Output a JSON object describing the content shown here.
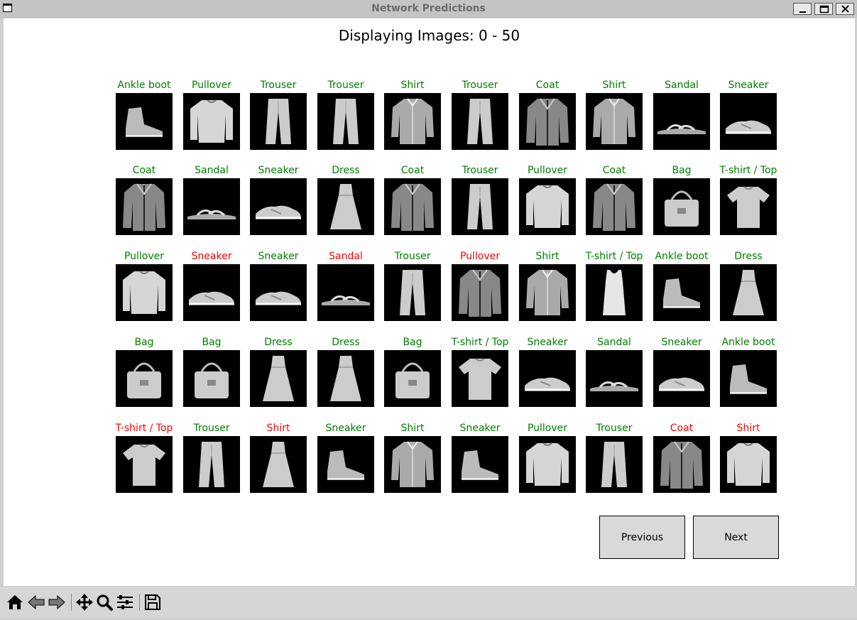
{
  "window": {
    "title": "Network Predictions"
  },
  "figure": {
    "title": "Displaying Images: 0 - 50"
  },
  "colors": {
    "correct": "#008000",
    "incorrect": "#ff0000"
  },
  "grid": [
    [
      {
        "label": "Ankle boot",
        "correct": true,
        "item": "ankle-boot"
      },
      {
        "label": "Pullover",
        "correct": true,
        "item": "pullover"
      },
      {
        "label": "Trouser",
        "correct": true,
        "item": "trouser"
      },
      {
        "label": "Trouser",
        "correct": true,
        "item": "trouser"
      },
      {
        "label": "Shirt",
        "correct": true,
        "item": "shirt"
      },
      {
        "label": "Trouser",
        "correct": true,
        "item": "trouser"
      },
      {
        "label": "Coat",
        "correct": true,
        "item": "coat"
      },
      {
        "label": "Shirt",
        "correct": true,
        "item": "shirt"
      },
      {
        "label": "Sandal",
        "correct": true,
        "item": "sandal"
      },
      {
        "label": "Sneaker",
        "correct": true,
        "item": "sneaker"
      }
    ],
    [
      {
        "label": "Coat",
        "correct": true,
        "item": "coat"
      },
      {
        "label": "Sandal",
        "correct": true,
        "item": "sandal"
      },
      {
        "label": "Sneaker",
        "correct": true,
        "item": "sneaker"
      },
      {
        "label": "Dress",
        "correct": true,
        "item": "dress"
      },
      {
        "label": "Coat",
        "correct": true,
        "item": "coat"
      },
      {
        "label": "Trouser",
        "correct": true,
        "item": "trouser"
      },
      {
        "label": "Pullover",
        "correct": true,
        "item": "pullover"
      },
      {
        "label": "Coat",
        "correct": true,
        "item": "coat"
      },
      {
        "label": "Bag",
        "correct": true,
        "item": "bag"
      },
      {
        "label": "T-shirt / Top",
        "correct": true,
        "item": "tshirt"
      }
    ],
    [
      {
        "label": "Pullover",
        "correct": true,
        "item": "pullover"
      },
      {
        "label": "Sneaker",
        "correct": false,
        "item": "sneaker"
      },
      {
        "label": "Sneaker",
        "correct": true,
        "item": "sneaker"
      },
      {
        "label": "Sandal",
        "correct": false,
        "item": "sandal"
      },
      {
        "label": "Trouser",
        "correct": true,
        "item": "trouser"
      },
      {
        "label": "Pullover",
        "correct": false,
        "item": "coat"
      },
      {
        "label": "Shirt",
        "correct": true,
        "item": "shirt"
      },
      {
        "label": "T-shirt / Top",
        "correct": true,
        "item": "tank"
      },
      {
        "label": "Ankle boot",
        "correct": true,
        "item": "ankle-boot"
      },
      {
        "label": "Dress",
        "correct": true,
        "item": "dress"
      }
    ],
    [
      {
        "label": "Bag",
        "correct": true,
        "item": "bag"
      },
      {
        "label": "Bag",
        "correct": true,
        "item": "bag"
      },
      {
        "label": "Dress",
        "correct": true,
        "item": "dress"
      },
      {
        "label": "Dress",
        "correct": true,
        "item": "dress"
      },
      {
        "label": "Bag",
        "correct": true,
        "item": "bag"
      },
      {
        "label": "T-shirt / Top",
        "correct": true,
        "item": "tshirt"
      },
      {
        "label": "Sneaker",
        "correct": true,
        "item": "sneaker"
      },
      {
        "label": "Sandal",
        "correct": true,
        "item": "sandal"
      },
      {
        "label": "Sneaker",
        "correct": true,
        "item": "sneaker"
      },
      {
        "label": "Ankle boot",
        "correct": true,
        "item": "ankle-boot"
      }
    ],
    [
      {
        "label": "T-shirt / Top",
        "correct": false,
        "item": "tshirt"
      },
      {
        "label": "Trouser",
        "correct": true,
        "item": "trouser"
      },
      {
        "label": "Shirt",
        "correct": false,
        "item": "dress"
      },
      {
        "label": "Sneaker",
        "correct": true,
        "item": "ankle-boot"
      },
      {
        "label": "Shirt",
        "correct": true,
        "item": "shirt"
      },
      {
        "label": "Sneaker",
        "correct": true,
        "item": "ankle-boot"
      },
      {
        "label": "Pullover",
        "correct": true,
        "item": "pullover"
      },
      {
        "label": "Trouser",
        "correct": true,
        "item": "trouser"
      },
      {
        "label": "Coat",
        "correct": false,
        "item": "coat"
      },
      {
        "label": "Shirt",
        "correct": false,
        "item": "pullover"
      }
    ]
  ],
  "buttons": {
    "previous": "Previous",
    "next": "Next"
  },
  "toolbar": {
    "items": [
      {
        "icon": "home-icon"
      },
      {
        "icon": "back-icon"
      },
      {
        "icon": "forward-icon"
      },
      {
        "icon": "pan-icon"
      },
      {
        "icon": "zoom-icon"
      },
      {
        "icon": "configure-subplots-icon"
      },
      {
        "icon": "save-icon"
      }
    ]
  }
}
